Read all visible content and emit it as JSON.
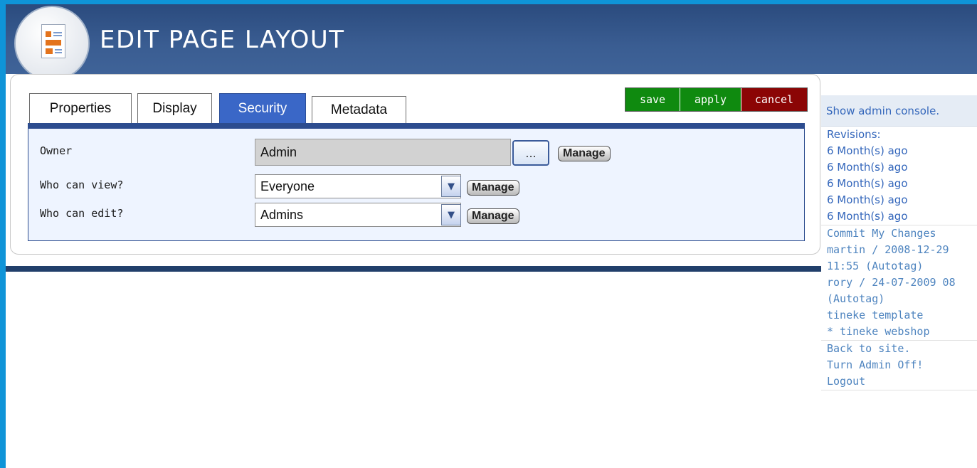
{
  "header": {
    "title": "EDIT PAGE LAYOUT",
    "icon": "page-layout-icon"
  },
  "tabs": [
    {
      "label": "Properties",
      "active": false
    },
    {
      "label": "Display",
      "active": false
    },
    {
      "label": "Security",
      "active": true
    },
    {
      "label": "Metadata",
      "active": false
    }
  ],
  "actions": {
    "save": "save",
    "apply": "apply",
    "cancel": "cancel",
    "save_color": "#0f8a0f",
    "apply_color": "#0f8a0f",
    "cancel_color": "#8b0505"
  },
  "form": {
    "owner": {
      "label": "Owner",
      "value": "Admin",
      "browse": "...",
      "manage": "Manage"
    },
    "view": {
      "label": "Who can view?",
      "value": "Everyone",
      "manage": "Manage"
    },
    "edit": {
      "label": "Who can edit?",
      "value": "Admins",
      "manage": "Manage"
    }
  },
  "sidebar": {
    "admin_console": "Show admin console.",
    "revisions_title": "Revisions:",
    "revisions": [
      "6 Month(s) ago",
      "6 Month(s) ago",
      "6 Month(s) ago",
      "6 Month(s) ago",
      "6 Month(s) ago"
    ],
    "commits": [
      "Commit My Changes",
      "martin / 2008-12-29",
      "11:55 (Autotag)",
      "rory / 24-07-2009 08",
      "(Autotag)",
      "tineke template",
      "* tineke webshop"
    ],
    "links": [
      "Back to site.",
      "Turn Admin Off!",
      "Logout"
    ]
  }
}
